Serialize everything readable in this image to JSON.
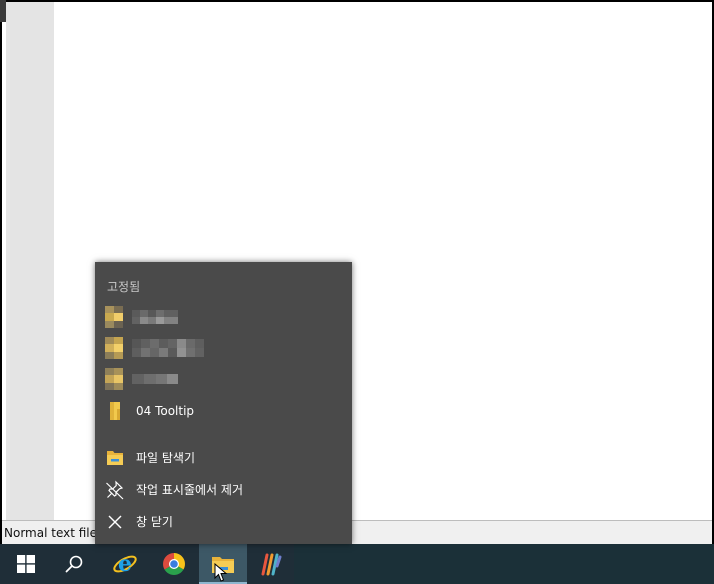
{
  "status_bar": {
    "file_type": "Normal text file"
  },
  "jump_list": {
    "pinned_header": "고정됨",
    "pinned_items": [
      {
        "label": "",
        "redacted": true,
        "icon": "folder-icon"
      },
      {
        "label": "",
        "redacted": true,
        "icon": "folder-icon"
      },
      {
        "label": "",
        "redacted": true,
        "icon": "folder-icon"
      },
      {
        "label": "04 Tooltip",
        "redacted": false,
        "icon": "folder-icon"
      }
    ],
    "tasks": [
      {
        "label": "파일 탐색기",
        "icon": "file-explorer-icon"
      },
      {
        "label": "작업 표시줄에서 제거",
        "icon": "unpin-icon"
      },
      {
        "label": "창 닫기",
        "icon": "close-icon"
      }
    ]
  },
  "taskbar": {
    "buttons": [
      {
        "name": "start-button",
        "icon": "windows-logo-icon"
      },
      {
        "name": "search-button",
        "icon": "search-icon"
      },
      {
        "name": "internet-explorer-button",
        "icon": "internet-explorer-icon"
      },
      {
        "name": "chrome-button",
        "icon": "chrome-icon"
      },
      {
        "name": "file-explorer-button",
        "icon": "file-explorer-icon",
        "active": true
      },
      {
        "name": "app-button",
        "icon": "colorful-bars-app-icon"
      }
    ]
  },
  "colors": {
    "taskbar_bg": "#1f2e38",
    "jumplist_bg": "#4a4a4a",
    "active_button_bg": "#3d5866",
    "folder_yellow": "#f2c94c"
  }
}
